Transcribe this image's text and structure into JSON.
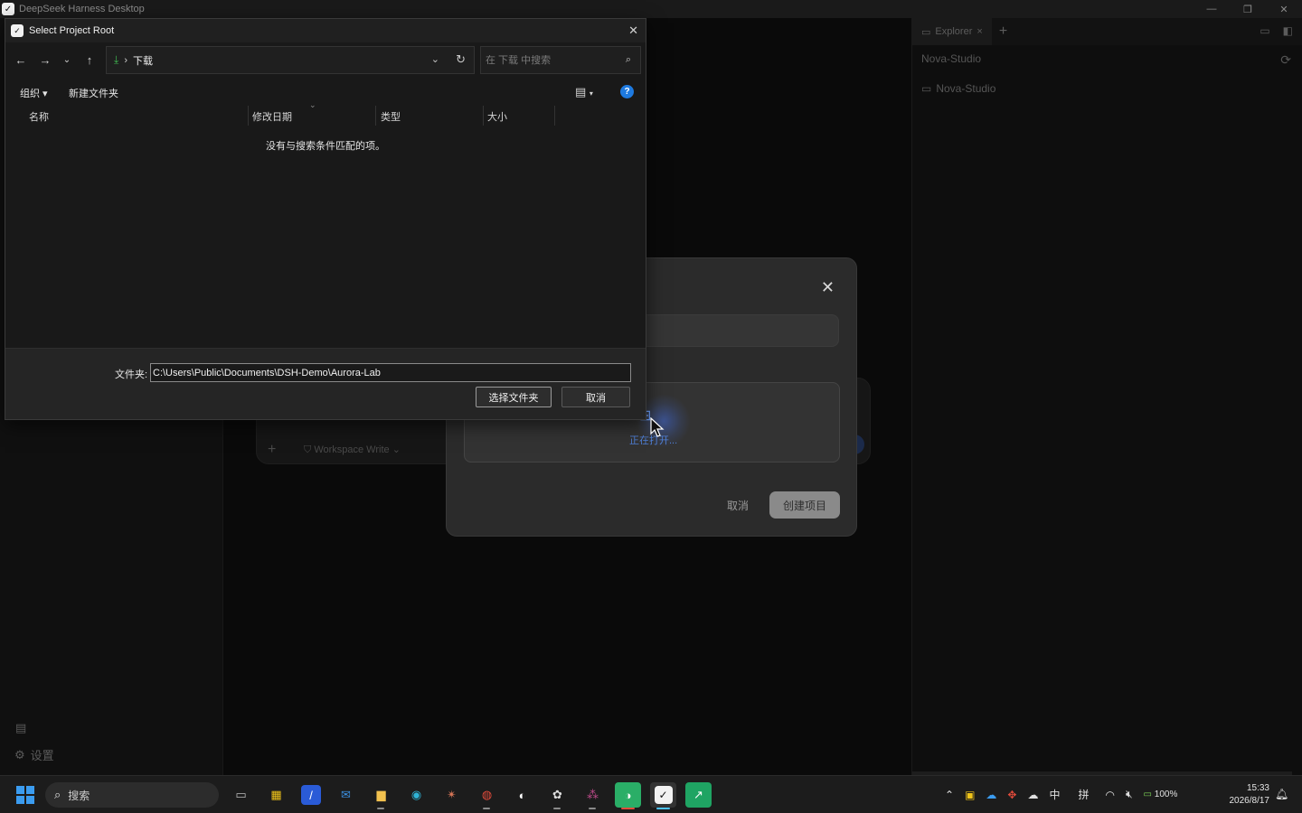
{
  "app": {
    "window_title": "DeepSeek Harness Desktop",
    "settings_label": "设置",
    "composer_mode": "Workspace Write"
  },
  "right_panel": {
    "tab_label": "Explorer",
    "project_name": "Nova-Studio",
    "tree_item": "Nova-Studio"
  },
  "create_modal": {
    "drop_status": "正在打开...",
    "cancel_label": "取消",
    "create_label": "创建项目"
  },
  "file_dialog": {
    "title": "Select Project Root",
    "breadcrumb": "下载",
    "search_placeholder": "在 下载 中搜索",
    "organize_label": "组织",
    "new_folder_label": "新建文件夹",
    "columns": [
      "名称",
      "修改日期",
      "类型",
      "大小"
    ],
    "empty_message": "没有与搜索条件匹配的项。",
    "folder_label": "文件夹:",
    "folder_path": "C:\\Users\\Public\\Documents\\DSH-Demo\\Aurora-Lab",
    "select_button": "选择文件夹",
    "cancel_button": "取消"
  },
  "taskbar": {
    "search_label": "搜索",
    "ime_mode": "中",
    "ime_pinyin": "拼",
    "battery": "100%",
    "time": "15:33",
    "date": "2026/8/17"
  },
  "colors": {
    "accent_blue": "#1e7ae0",
    "download_green": "#3fb950",
    "start_blue": "#3b9cf0"
  }
}
